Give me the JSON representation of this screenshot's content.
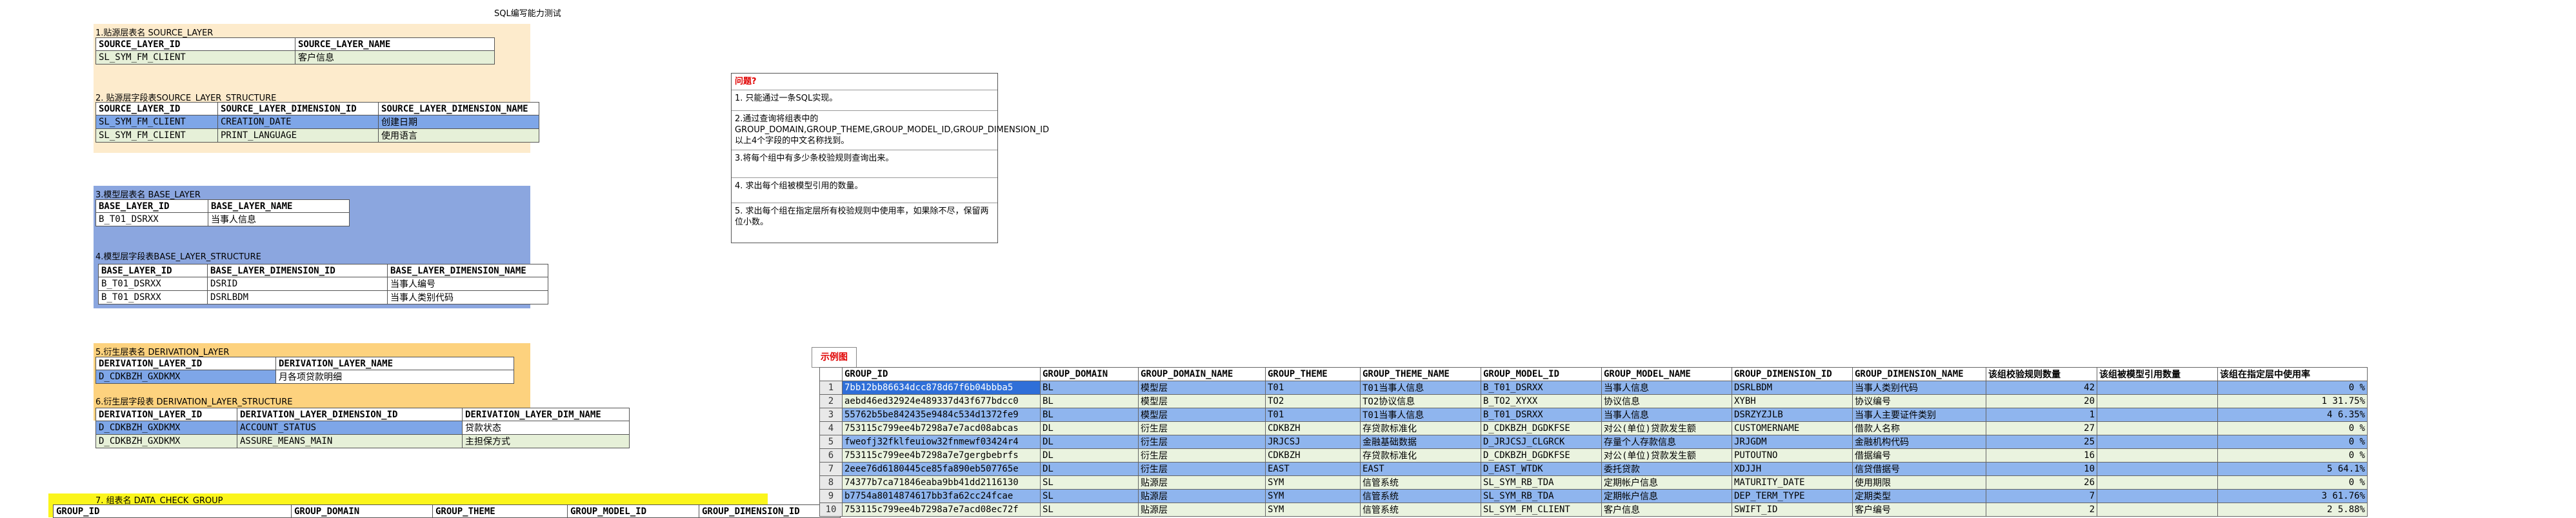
{
  "title": "SQL编写能力测试",
  "s1": {
    "label": "1.贴源层表名    SOURCE_LAYER",
    "headers": [
      "SOURCE_LAYER_ID",
      "SOURCE_LAYER_NAME"
    ],
    "rows": [
      [
        "SL_SYM_FM_CLIENT",
        "客户信息"
      ]
    ]
  },
  "s2": {
    "label": "2. 贴源层字段表SOURCE_LAYER_STRUCTURE",
    "headers": [
      "SOURCE_LAYER_ID",
      "SOURCE_LAYER_DIMENSION_ID",
      "SOURCE_LAYER_DIMENSION_NAME"
    ],
    "rows": [
      [
        "SL_SYM_FM_CLIENT",
        "CREATION_DATE",
        "创建日期"
      ],
      [
        "SL_SYM_FM_CLIENT",
        "PRINT_LANGUAGE",
        "使用语言"
      ]
    ]
  },
  "s3": {
    "label": "3.模型层表名    BASE_LAYER",
    "headers": [
      "BASE_LAYER_ID",
      "BASE_LAYER_NAME"
    ],
    "rows": [
      [
        "B_T01_DSRXX",
        "当事人信息"
      ]
    ]
  },
  "s4": {
    "label": "4.模型层字段表BASE_LAYER_STRUCTURE",
    "headers": [
      "BASE_LAYER_ID",
      "BASE_LAYER_DIMENSION_ID",
      "BASE_LAYER_DIMENSION_NAME"
    ],
    "rows": [
      [
        "B_T01_DSRXX",
        "DSRID",
        "当事人编号"
      ],
      [
        "B_T01_DSRXX",
        "DSRLBDM",
        "当事人类别代码"
      ]
    ]
  },
  "s5": {
    "label": "5.衍生层表名    DERIVATION_LAYER",
    "headers": [
      "DERIVATION_LAYER_ID",
      "DERIVATION_LAYER_NAME"
    ],
    "rows": [
      [
        "D_CDKBZH_GXDKMX",
        "月各项贷款明细"
      ]
    ]
  },
  "s6": {
    "label": "6.衍生层字段表 DERIVATION_LAYER_STRUCTURE",
    "headers": [
      "DERIVATION_LAYER_ID",
      "DERIVATION_LAYER_DIMENSION_ID",
      "DERIVATION_LAYER_DIM_NAME"
    ],
    "rows": [
      [
        "D_CDKBZH_GXDKMX",
        "ACCOUNT_STATUS",
        "贷款状态"
      ],
      [
        "D_CDKBZH_GXDKMX",
        "ASSURE_MEANS_MAIN",
        "主担保方式"
      ]
    ]
  },
  "s7": {
    "label": "7. 组表名          DATA_CHECK_GROUP",
    "headers": [
      "GROUP_ID",
      "GROUP_DOMAIN",
      "GROUP_THEME",
      "GROUP_MODEL_ID",
      "GROUP_DIMENSION_ID"
    ]
  },
  "questions": {
    "title": "问题?",
    "items": [
      "1. 只能通过一条SQL实现。",
      "2.通过查询将组表中的GROUP_DOMAIN,GROUP_THEME,GROUP_MODEL_ID,GROUP_DIMENSION_ID以上4个字段的中文名称找到。",
      "3.将每个组中有多少条校验规则查询出来。",
      "4. 求出每个组被模型引用的数量。",
      "5. 求出每个组在指定层所有校验规则中使用率，如果除不尽，保留两位小数。"
    ]
  },
  "example": {
    "tab_label": "示例图",
    "headers": [
      "GROUP_ID",
      "GROUP_DOMAIN",
      "GROUP_DOMAIN_NAME",
      "GROUP_THEME",
      "GROUP_THEME_NAME",
      "GROUP_MODEL_ID",
      "GROUP_MODEL_NAME",
      "GROUP_DIMENSION_ID",
      "GROUP_DIMENSION_NAME",
      "该组校验规则数量",
      "该组被模型引用数量",
      "该组在指定层中使用率"
    ],
    "rows": [
      [
        "1",
        "7bb12bb86634dcc878d67f6b04bbba5",
        "BL",
        "模型层",
        "T01",
        "T01当事人信息",
        "B_T01_DSRXX",
        "当事人信息",
        "DSRLBDM",
        "当事人类别代码",
        "42",
        "",
        "0 %"
      ],
      [
        "2",
        "aebd46ed32924e489337d43f677bdcc0",
        "BL",
        "模型层",
        "TO2",
        "TO2协议信息",
        "B_TO2_XYXX",
        "协议信息",
        "XYBH",
        "协议编号",
        "20",
        "",
        "1 31.75%"
      ],
      [
        "3",
        "55762b5be842435e9484c534d1372fe9",
        "BL",
        "模型层",
        "T01",
        "T01当事人信息",
        "B_T01_DSRXX",
        "当事人信息",
        "DSRZYZJLB",
        "当事人主要证件类别",
        "1",
        "",
        "4 6.35%"
      ],
      [
        "4",
        "753115c799ee4b7298a7e7acd08abcas",
        "DL",
        "衍生层",
        "CDKBZH",
        "存贷款标准化",
        "D_CDKBZH_DGDKFSE",
        "对公(单位)贷款发生额",
        "CUSTOMERNAME",
        "借款人名称",
        "27",
        "",
        "0 %"
      ],
      [
        "5",
        "fweofj32fklfeuiow32fnmewf03424r4",
        "DL",
        "衍生层",
        "JRJCSJ",
        "金融基础数据",
        "D_JRJCSJ_CLGRCK",
        "存量个人存款信息",
        "JRJGDM",
        "金融机构代码",
        "25",
        "",
        "0 %"
      ],
      [
        "6",
        "753115c799ee4b7298a7e7gergbebrfs",
        "DL",
        "衍生层",
        "CDKBZH",
        "存贷款标准化",
        "D_CDKBZH_DGDKFSE",
        "对公(单位)贷款发生额",
        "PUTOUTNO",
        "借据编号",
        "16",
        "",
        "0 %"
      ],
      [
        "7",
        "2eee76d6180445ce85fa890eb507765e",
        "DL",
        "衍生层",
        "EAST",
        "EAST",
        "D_EAST_WTDK",
        "委托贷款",
        "XDJJH",
        "信贷借据号",
        "10",
        "",
        "5 64.1%"
      ],
      [
        "8",
        "74377b7ca71846eaba9bb41dd2116130",
        "SL",
        "贴源层",
        "SYM",
        "信管系统",
        "SL_SYM_RB_TDA",
        "定期帐户信息",
        "MATURITY_DATE",
        "使用期限",
        "26",
        "",
        "0 %"
      ],
      [
        "9",
        "b7754a8014874617bb3fa62cc24fcae",
        "SL",
        "贴源层",
        "SYM",
        "信管系统",
        "SL_SYM_RB_TDA",
        "定期帐户信息",
        "DEP_TERM_TYPE",
        "定期类型",
        "7",
        "",
        "3 61.76%"
      ],
      [
        "10",
        "753115c799ee4b7298a7e7acd08ec72f",
        "SL",
        "贴源层",
        "SYM",
        "信管系统",
        "SL_SYM_FM_CLIENT",
        "客户信息",
        "SWIFT_ID",
        "客户编号",
        "2",
        "",
        "2 5.88%"
      ]
    ]
  },
  "colors": {
    "peach": "#fdebcc",
    "blue_band": "#8ba6df",
    "orange_band": "#fdd27e",
    "yellow_band": "#fbf51c",
    "selected": "#7ea6e8",
    "green_row": "#e6f0d8"
  }
}
